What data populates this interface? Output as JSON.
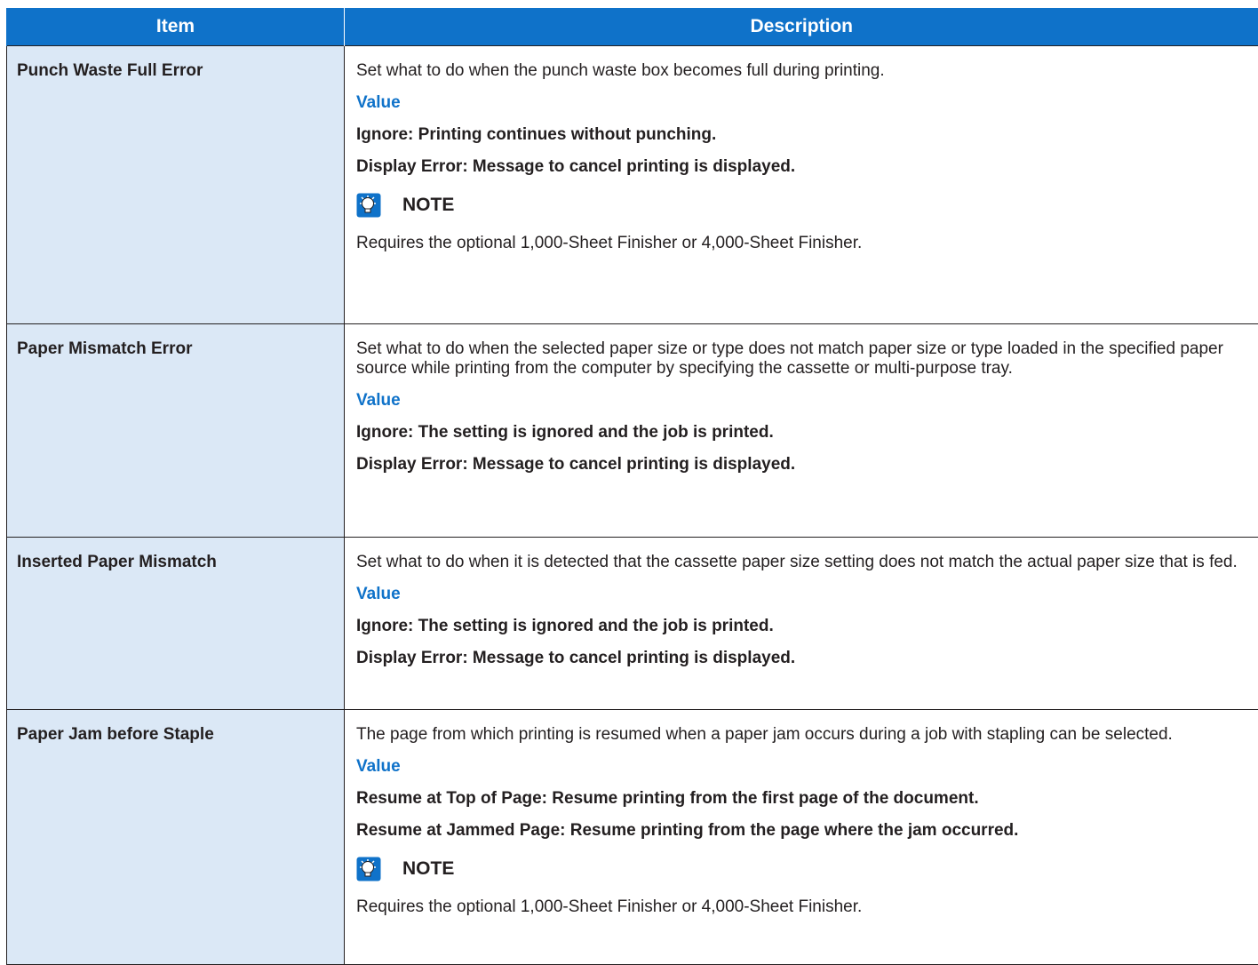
{
  "header": {
    "item": "Item",
    "description": "Description"
  },
  "rows": [
    {
      "item": "Punch Waste Full Error",
      "description": "Set what to do when the punch waste box becomes full during printing.",
      "value_label": "Value",
      "option1": "Ignore: Printing continues without punching.",
      "option2": "Display Error: Message to cancel printing is displayed.",
      "note_label": "NOTE",
      "note_text": "Requires the optional 1,000-Sheet Finisher or 4,000-Sheet Finisher."
    },
    {
      "item": "Paper Mismatch Error",
      "description": "Set what to do when the selected paper size or type does not match paper size or type loaded in the specified paper source while printing from the computer by specifying the cassette or multi-purpose tray.",
      "value_label": "Value",
      "option1": "Ignore: The setting is ignored and the job is printed.",
      "option2": "Display Error: Message to cancel printing is displayed."
    },
    {
      "item": "Inserted Paper Mismatch",
      "description": "Set what to do when it is detected that the cassette paper size setting does not match the actual paper size that is fed.",
      "value_label": "Value",
      "option1": "Ignore: The setting is ignored and the job is printed.",
      "option2": "Display Error: Message to cancel printing is displayed."
    },
    {
      "item": "Paper Jam before Staple",
      "description": "The page from which printing is resumed when a paper jam occurs during a job with stapling can be selected.",
      "value_label": "Value",
      "option1": "Resume at Top of Page: Resume printing from the first page of the document.",
      "option2": "Resume at Jammed Page: Resume printing from the page where the jam occurred.",
      "note_label": "NOTE",
      "note_text": "Requires the optional 1,000-Sheet Finisher or 4,000-Sheet Finisher."
    }
  ],
  "icons": {
    "note": "note-lightbulb-icon"
  },
  "colors": {
    "header_bg": "#0f72c9",
    "item_bg": "#dbe8f6",
    "label_blue": "#0f72c9"
  }
}
